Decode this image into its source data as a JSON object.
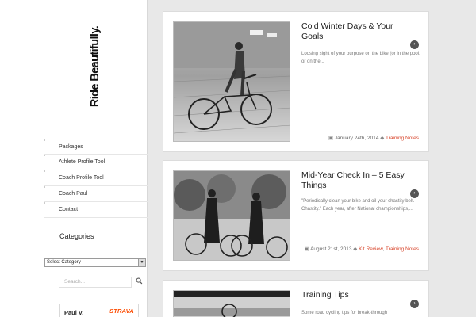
{
  "site": {
    "logo": "Ride Beautifully."
  },
  "nav": {
    "items": [
      {
        "label": "Packages"
      },
      {
        "label": "Athlete Profile Tool"
      },
      {
        "label": "Coach Profile Tool"
      },
      {
        "label": "Coach Paul"
      },
      {
        "label": "Contact"
      }
    ]
  },
  "sidebar": {
    "categories_title": "Categories",
    "category_select": "Select Category",
    "search_placeholder": "Search...",
    "search_icon": "search-icon",
    "strava_name": "Paul V.",
    "strava_brand": "STRAVA"
  },
  "posts": [
    {
      "title": "Cold Winter Days & Your Goals",
      "excerpt": "Loosing sight of your purpose on the bike (or in the pool, or on the...",
      "date": "January 24th, 2014",
      "categories": [
        "Training Notes"
      ]
    },
    {
      "title": "Mid-Year Check In – 5 Easy Things",
      "excerpt": "\"Periodically clean your bike and oil your chastity belt. Chastity.\" Each year, after National championships,...",
      "date": "August 21st, 2013",
      "categories": [
        "Kit Review",
        "Training Notes"
      ]
    },
    {
      "title": "Training Tips",
      "excerpt": "Some road cycling tips for break-through",
      "date": "",
      "categories": []
    }
  ],
  "colors": {
    "accent": "#d8452b",
    "strava": "#fc4c02",
    "background": "#e8e8e8"
  }
}
